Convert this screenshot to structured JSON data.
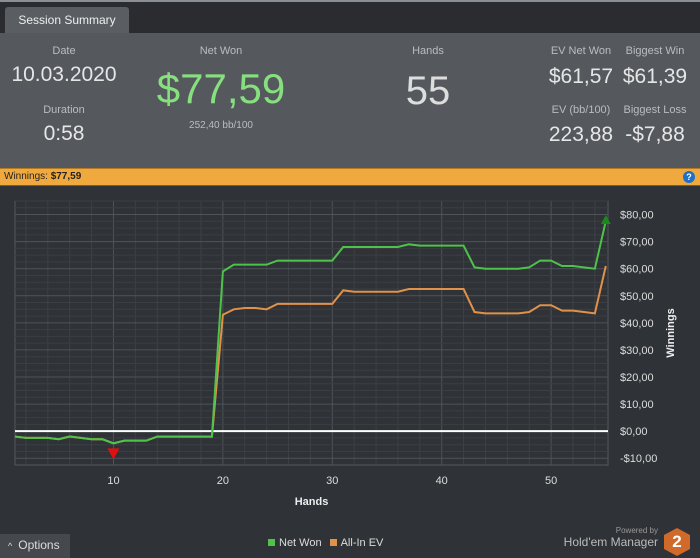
{
  "tab": {
    "label": "Session Summary"
  },
  "summary": {
    "date_label": "Date",
    "date": "10.03.2020",
    "duration_label": "Duration",
    "duration": "0:58",
    "net_won_label": "Net Won",
    "net_won": "$77,59",
    "bb100": "252,40 bb/100",
    "hands_label": "Hands",
    "hands": "55",
    "ev_net_won_label": "EV Net Won",
    "ev_net_won": "$61,57",
    "biggest_win_label": "Biggest Win",
    "biggest_win": "$61,39",
    "ev_bb_label": "EV (bb/100)",
    "ev_bb": "223,88",
    "biggest_loss_label": "Biggest Loss",
    "biggest_loss": "-$7,88"
  },
  "winnings_bar": {
    "label": "Winnings:",
    "value": "$77,59",
    "help_icon": "question-icon"
  },
  "chart_data": {
    "type": "line",
    "xlabel": "Hands",
    "ylabel": "Winnings",
    "xlim": [
      1,
      55.2
    ],
    "ylim": [
      -12.5,
      85
    ],
    "x_ticks": [
      10,
      20,
      30,
      40,
      50
    ],
    "y_ticks": [
      "-$10,00",
      "$0,00",
      "$10,00",
      "$20,00",
      "$30,00",
      "$40,00",
      "$50,00",
      "$60,00",
      "$70,00",
      "$80,00"
    ],
    "y_tick_values": [
      -10,
      0,
      10,
      20,
      30,
      40,
      50,
      60,
      70,
      80
    ],
    "grid": true,
    "legend_position": "bottom",
    "series": [
      {
        "name": "Net Won",
        "color": "#4fc24a",
        "values": [
          -2,
          -2.5,
          -2.5,
          -2.5,
          -3,
          -2,
          -2.5,
          -3,
          -3,
          -4.5,
          -3.5,
          -3.5,
          -3.5,
          -2,
          -2,
          -2,
          -2,
          -2,
          -2,
          59,
          61.5,
          61.5,
          61.5,
          61.5,
          63,
          63,
          63,
          63,
          63,
          63,
          68,
          68,
          68,
          68,
          68,
          68,
          69,
          68.5,
          68.5,
          68.5,
          68.5,
          68.5,
          60.5,
          60,
          60,
          60,
          60,
          60.5,
          63,
          63,
          61,
          61,
          60.5,
          60,
          77.59
        ]
      },
      {
        "name": "All-In EV",
        "color": "#e0914a",
        "values": [
          -2,
          -2.5,
          -2.5,
          -2.5,
          -3,
          -2,
          -2.5,
          -3,
          -3,
          -4.5,
          -3.5,
          -3.5,
          -3.5,
          -2,
          -2,
          -2,
          -2,
          -2,
          -2,
          43,
          45,
          45.5,
          45.5,
          45,
          47,
          47,
          47,
          47,
          47,
          47,
          52,
          51.5,
          51.5,
          51.5,
          51.5,
          51.5,
          52.5,
          52.5,
          52.5,
          52.5,
          52.5,
          52.5,
          44,
          43.5,
          43.5,
          43.5,
          43.5,
          44,
          46.5,
          46.5,
          44.5,
          44.5,
          44,
          43.5,
          61
        ]
      }
    ],
    "markers": [
      {
        "hand": 10,
        "type": "min",
        "color": "#e01010"
      },
      {
        "hand": 55,
        "type": "max",
        "color": "#1a8a1a"
      }
    ]
  },
  "footer": {
    "options_label": "Options",
    "powered_by": "Powered by",
    "brand": "Hold'em Manager",
    "brand_version": "2"
  }
}
